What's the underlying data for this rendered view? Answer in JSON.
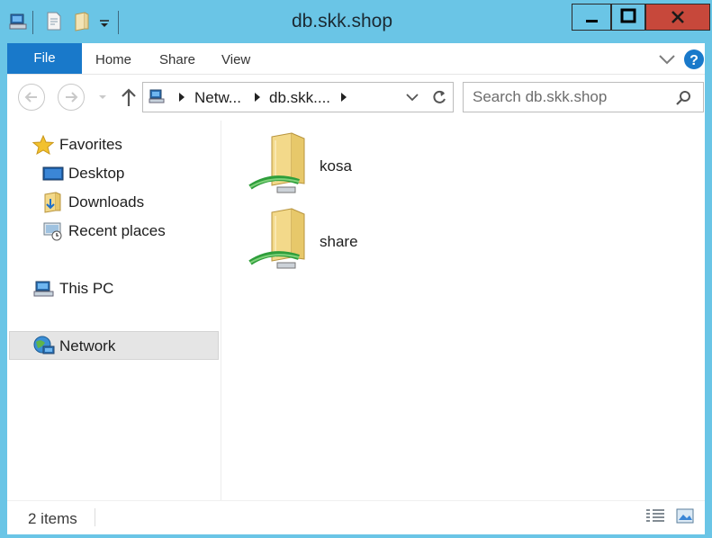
{
  "window": {
    "title": "db.skk.shop",
    "min_label": "Minimize",
    "max_label": "Maximize",
    "close_label": "Close"
  },
  "ribbon": {
    "file_label": "File",
    "tabs": [
      {
        "label": "Home"
      },
      {
        "label": "Share"
      },
      {
        "label": "View"
      }
    ]
  },
  "address": {
    "crumbs": [
      "Netw...",
      "db.skk...."
    ],
    "search_placeholder": "Search db.skk.shop"
  },
  "sidebar": {
    "favorites": {
      "label": "Favorites",
      "items": [
        {
          "label": "Desktop"
        },
        {
          "label": "Downloads"
        },
        {
          "label": "Recent places"
        }
      ]
    },
    "this_pc": {
      "label": "This PC"
    },
    "network": {
      "label": "Network",
      "selected": true
    }
  },
  "content": {
    "items": [
      {
        "name": "kosa",
        "icon": "network-share-folder-icon"
      },
      {
        "name": "share",
        "icon": "network-share-folder-icon"
      }
    ]
  },
  "status": {
    "item_count": "2 items"
  },
  "colors": {
    "frame": "#6ac5e6",
    "file_tab": "#1979ca",
    "close": "#c7483b",
    "help": "#1979ca"
  }
}
